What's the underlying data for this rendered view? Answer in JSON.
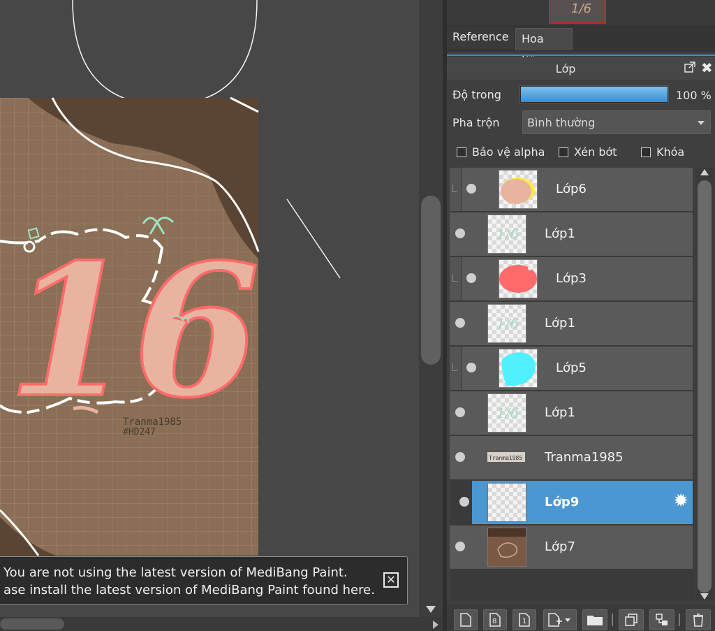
{
  "notification": {
    "line1": "You are not using the latest version of MediBang Paint.",
    "line2": "ase install the latest version of MediBang Paint found here."
  },
  "artwork": {
    "big_text": "16",
    "signature": "Tranma1985",
    "hashtag": "#HD247"
  },
  "navigator": {
    "preview_text": "1/6"
  },
  "tabs": [
    {
      "label": "Reference"
    },
    {
      "label": "Hoa tiêu"
    }
  ],
  "layer_panel": {
    "title": "Lớp",
    "opacity": {
      "label": "Độ trong",
      "value": "100 %",
      "level": 1.0
    },
    "blend": {
      "label": "Pha trộn",
      "value": "Bình thường"
    },
    "checkboxes": [
      {
        "label": "Bảo vệ alpha"
      },
      {
        "label": "Xén bớt"
      },
      {
        "label": "Khóa"
      }
    ],
    "layers": [
      {
        "name": "Lớp6",
        "clipped": true,
        "thumb": "peach-blob-icon",
        "thumb_color": "#e8b4a0"
      },
      {
        "name": "Lớp1",
        "clipped": false,
        "thumb": "text-sketch-icon",
        "thumb_color": "#a8d8c0"
      },
      {
        "name": "Lớp3",
        "clipped": true,
        "thumb": "red-blob-icon",
        "thumb_color": "#ff6b6b"
      },
      {
        "name": "Lớp1",
        "clipped": false,
        "thumb": "text-sketch-icon",
        "thumb_color": "#a8d8c0"
      },
      {
        "name": "Lớp5",
        "clipped": true,
        "thumb": "cyan-blob-icon",
        "thumb_color": "#50f0ff"
      },
      {
        "name": "Lớp1",
        "clipped": false,
        "thumb": "text-sketch-icon",
        "thumb_color": "#a8d8c0"
      },
      {
        "name": "Tranma1985",
        "clipped": false,
        "thumb": "signature-icon",
        "thumb_color": "#888888"
      },
      {
        "name": "Lớp9",
        "clipped": false,
        "selected": true,
        "thumb": "empty-icon",
        "thumb_color": "#ffffff"
      },
      {
        "name": "Lớp7",
        "clipped": false,
        "thumb": "brown-background-icon",
        "thumb_color": "#7a5a45"
      }
    ]
  },
  "colors": {
    "accent": "#4b97d1",
    "canvas_brown": "#8a6e55",
    "canvas_dark_brown": "#5a4433"
  }
}
